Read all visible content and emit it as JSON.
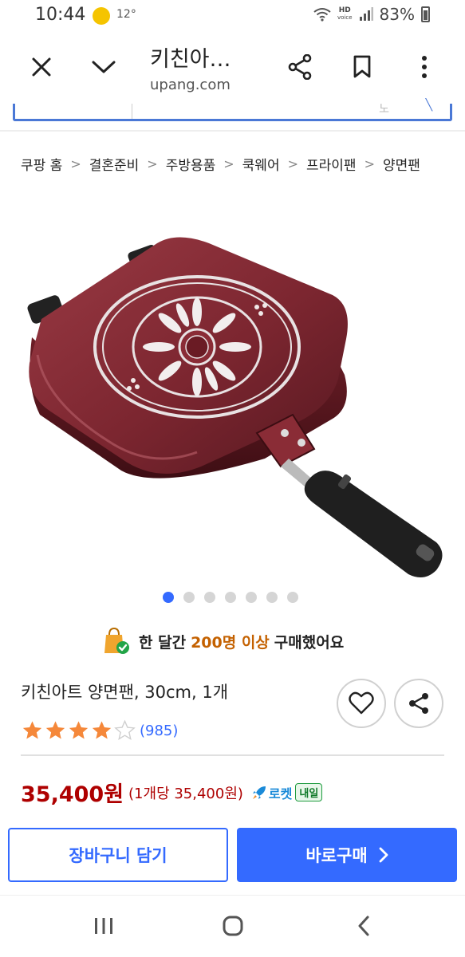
{
  "status_bar": {
    "time": "10:44",
    "notification": "12°",
    "hd_label": "HD",
    "volte_label": "voice",
    "battery": "83%"
  },
  "browser": {
    "title": "키친아…",
    "url": "upang.com",
    "search_partial_text": "노"
  },
  "breadcrumb": [
    "쿠팡 홈",
    "결혼준비",
    "주방용품",
    "쿡웨어",
    "프라이팬",
    "양면팬"
  ],
  "gallery": {
    "total_images": 7,
    "current_index": 1
  },
  "purchase_info": {
    "prefix": "한 달간",
    "count": "200명 이상",
    "suffix": "구매했어요"
  },
  "product": {
    "title": "키친아트 양면팬, 30cm, 1개",
    "rating": 4,
    "max_rating": 5,
    "review_count": "(985)"
  },
  "pricing": {
    "price": "35,400원",
    "unit_price": "(1개당 35,400원)",
    "rocket_label": "로켓",
    "delivery_badge": "내일"
  },
  "actions": {
    "cart_label": "장바구니 담기",
    "buy_label": "바로구매"
  },
  "colors": {
    "accent": "#346aff",
    "price": "#ae0000",
    "highlight": "#c46100",
    "star": "#f5883a"
  }
}
